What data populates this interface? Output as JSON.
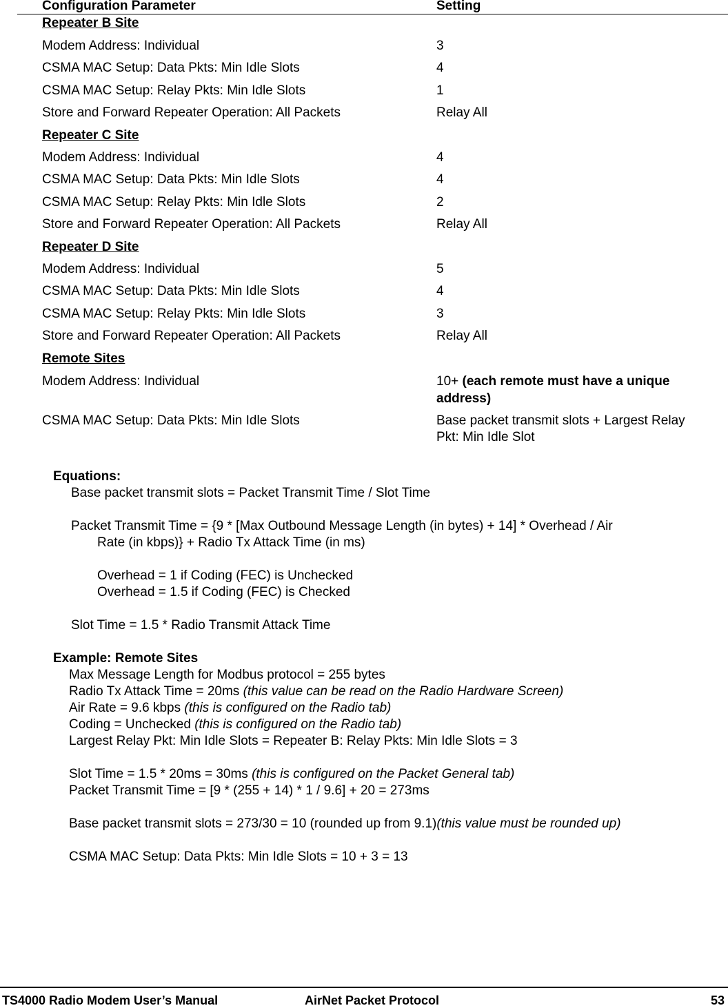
{
  "table": {
    "headers": {
      "parameter": "Configuration Parameter",
      "setting": "Setting"
    },
    "sections": [
      {
        "title": "Repeater B Site",
        "rows": [
          {
            "parameter": "Modem Address: Individual",
            "setting": "3"
          },
          {
            "parameter": "CSMA MAC Setup: Data Pkts: Min Idle Slots",
            "setting": "4"
          },
          {
            "parameter": "CSMA MAC Setup: Relay Pkts: Min Idle Slots",
            "setting": "1"
          },
          {
            "parameter": "Store and Forward Repeater Operation: All Packets",
            "setting": "Relay All"
          }
        ]
      },
      {
        "title": "Repeater C Site",
        "rows": [
          {
            "parameter": "Modem Address: Individual",
            "setting": "4"
          },
          {
            "parameter": "CSMA MAC Setup: Data Pkts: Min Idle Slots",
            "setting": "4"
          },
          {
            "parameter": "CSMA MAC Setup: Relay Pkts: Min Idle Slots",
            "setting": "2"
          },
          {
            "parameter": "Store and Forward Repeater Operation: All Packets",
            "setting": "Relay All"
          }
        ]
      },
      {
        "title": "Repeater D Site",
        "rows": [
          {
            "parameter": "Modem Address: Individual",
            "setting": "5"
          },
          {
            "parameter": "CSMA MAC Setup: Data Pkts: Min Idle Slots",
            "setting": "4"
          },
          {
            "parameter": "CSMA MAC Setup: Relay Pkts: Min Idle Slots",
            "setting": "3"
          },
          {
            "parameter": "Store and Forward Repeater Operation: All Packets",
            "setting": "Relay All"
          }
        ]
      },
      {
        "title": "Remote Sites",
        "rows": [
          {
            "parameter": "Modem Address: Individual",
            "setting_prefix": "10+ ",
            "setting_bold_line1": "(each remote must have a unique",
            "setting_bold_line2": "address)"
          },
          {
            "parameter": "CSMA MAC Setup: Data Pkts: Min Idle Slots",
            "setting_line1": "Base packet transmit slots + Largest Relay",
            "setting_line2": "Pkt: Min Idle Slot"
          }
        ]
      }
    ]
  },
  "equations": {
    "title": "Equations:",
    "base_slots": "Base packet transmit slots = Packet Transmit Time / Slot Time",
    "packet_time_line1": "Packet Transmit Time = {9 * [Max Outbound Message Length (in bytes) + 14] * Overhead / Air",
    "packet_time_line2": "Rate (in kbps)} + Radio Tx Attack Time (in ms)",
    "overhead_unchecked": "Overhead = 1 if Coding (FEC) is Unchecked",
    "overhead_checked": "Overhead = 1.5 if Coding (FEC) is Checked",
    "slot_time": "Slot Time = 1.5 * Radio Transmit Attack Time"
  },
  "example": {
    "title": "Example: Remote Sites",
    "max_msg": "Max Message Length for Modbus protocol = 255 bytes",
    "attack_time": "Radio Tx Attack Time = 20ms  ",
    "attack_time_note": "(this value can be read on the Radio Hardware Screen)",
    "air_rate": "Air Rate = 9.6 kbps  ",
    "air_rate_note": "(this is configured on the Radio tab)",
    "coding": "Coding = Unchecked  ",
    "coding_note": "(this is configured on the Radio tab)",
    "largest_relay": "Largest Relay Pkt: Min Idle Slots = Repeater B: Relay Pkts: Min Idle Slots = 3",
    "slot_time": "Slot Time = 1.5 * 20ms = 30ms  ",
    "slot_time_note": "(this is configured on the Packet General tab)",
    "packet_time": "Packet Transmit Time = [9 * (255 + 14) * 1 / 9.6] + 20 = 273ms",
    "base_slots": "Base packet transmit slots = 273/30 = 10 (rounded up from 9.1)",
    "base_slots_note": "(this value must be rounded up)",
    "result": "CSMA MAC Setup: Data Pkts: Min Idle Slots = 10 + 3 = 13"
  },
  "footer": {
    "manual_title": "TS4000 Radio Modem User’s Manual",
    "chapter": "AirNet Packet Protocol",
    "page_number": "53"
  }
}
